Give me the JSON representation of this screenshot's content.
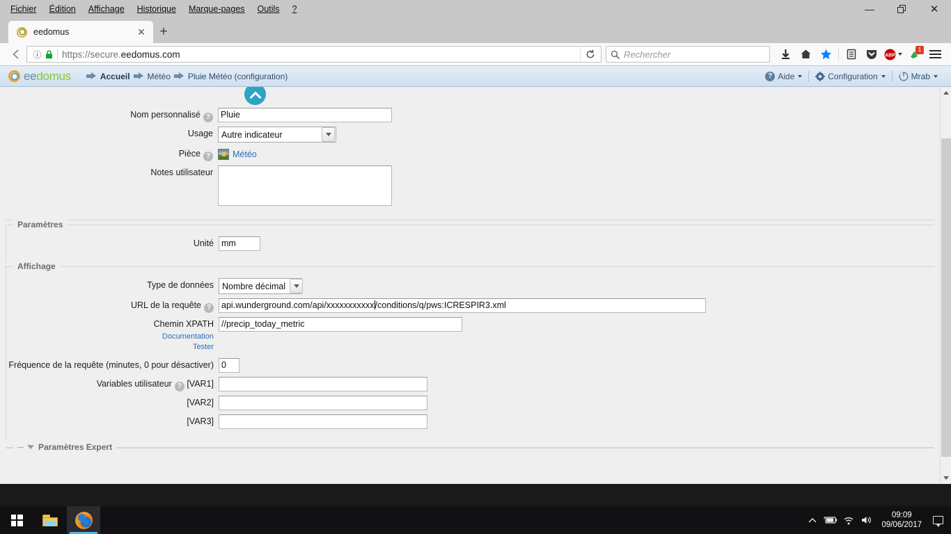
{
  "browser": {
    "menus": [
      {
        "label": "Fichier",
        "accel": "F"
      },
      {
        "label": "Édition",
        "accel": "n"
      },
      {
        "label": "Affichage",
        "accel": "A"
      },
      {
        "label": "Historique",
        "accel": "H"
      },
      {
        "label": "Marque-pages",
        "accel": "M"
      },
      {
        "label": "Outils",
        "accel": "O"
      },
      {
        "label": "?",
        "accel": "?"
      }
    ],
    "window_controls": {
      "minimize": "—",
      "restore": "❐",
      "close": "✕"
    },
    "tab": {
      "title": "eedomus",
      "favicon": "eedomus-ring-icon",
      "close": "✕"
    },
    "newtab_label": "+",
    "nav": {
      "back_icon": "back-arrow-icon",
      "identity_icon": "page-info-icon",
      "lock_icon": "secure-lock-icon",
      "url_scheme": "https://secure.",
      "url_domain": "eedomus.com",
      "url_full": "https://secure.eedomus.com",
      "reload_icon": "reload-icon"
    },
    "search": {
      "placeholder": "Rechercher",
      "icon": "search-icon"
    },
    "toolbar_icons": [
      {
        "name": "downloads-icon",
        "glyph": "⬇"
      },
      {
        "name": "home-icon",
        "glyph": "⌂"
      },
      {
        "name": "bookmark-star-icon",
        "glyph": "★"
      },
      {
        "name": "library-icon",
        "glyph": "▤"
      },
      {
        "name": "pocket-icon",
        "glyph": "⛊"
      },
      {
        "name": "adblock-plus-icon",
        "glyph": "ABP"
      },
      {
        "name": "extension-icon",
        "glyph": "✦",
        "badge": "1"
      },
      {
        "name": "menu-hamburger-icon",
        "glyph": "☰"
      }
    ]
  },
  "app": {
    "logo": {
      "part1": "ee",
      "part2": "domus"
    },
    "breadcrumbs": [
      {
        "label": "Accueil",
        "active": true
      },
      {
        "label": "Météo",
        "active": false
      },
      {
        "label": "Pluie Météo (configuration)",
        "active": false
      }
    ],
    "menu": [
      {
        "label": "Aide",
        "icon": "help-icon"
      },
      {
        "label": "Configuration",
        "icon": "gear-icon"
      },
      {
        "label": "Mrab",
        "icon": "power-icon"
      }
    ]
  },
  "form": {
    "collapse_button": "chevron-up-icon",
    "general": {
      "name_label": "Nom personnalisé",
      "name_value": "Pluie",
      "usage_label": "Usage",
      "usage_value": "Autre indicateur",
      "room_label": "Pièce",
      "room_value": "Météo",
      "room_icon": "room-thumbnail-icon",
      "notes_label": "Notes utilisateur",
      "notes_value": ""
    },
    "parametres": {
      "legend": "Paramètres",
      "unite_label": "Unité",
      "unite_value": "mm"
    },
    "affichage": {
      "legend": "Affichage",
      "datatype_label": "Type de données",
      "datatype_value": "Nombre décimal",
      "url_label": "URL de la requête",
      "url_value": "api.wunderground.com/api/xxxxxxxxxxx/conditions/q/pws:ICRESPIR3.xml",
      "url_value_prefix": "api.wunderground.com/api/xxxxxxxxxxx",
      "url_value_suffix": "/conditions/q/pws:ICRESPIR3.xml",
      "xpath_label": "Chemin XPATH",
      "xpath_value": "//precip_today_metric",
      "doc_link": "Documentation",
      "test_link": "Tester",
      "frequency_label": "Fréquence de la requête (minutes, 0 pour désactiver)",
      "frequency_value": "0",
      "variables_label": "Variables utilisateur",
      "var1_label": "[VAR1]",
      "var1_value": "",
      "var2_label": "[VAR2]",
      "var2_value": "",
      "var3_label": "[VAR3]",
      "var3_value": ""
    },
    "expert": {
      "legend": "Paramètres Expert",
      "toggle_icon": "triangle-down-icon"
    }
  },
  "taskbar": {
    "start_icon": "windows-start-icon",
    "explorer_icon": "file-explorer-icon",
    "firefox_icon": "firefox-icon",
    "tray": [
      {
        "name": "show-hidden-icons",
        "glyph": "⌃"
      },
      {
        "name": "battery-icon",
        "glyph": "▭"
      },
      {
        "name": "wifi-icon",
        "glyph": "◗"
      },
      {
        "name": "volume-icon",
        "glyph": "🔊"
      }
    ],
    "time": "09:09",
    "date": "09/06/2017",
    "action_center_icon": "action-center-icon"
  }
}
